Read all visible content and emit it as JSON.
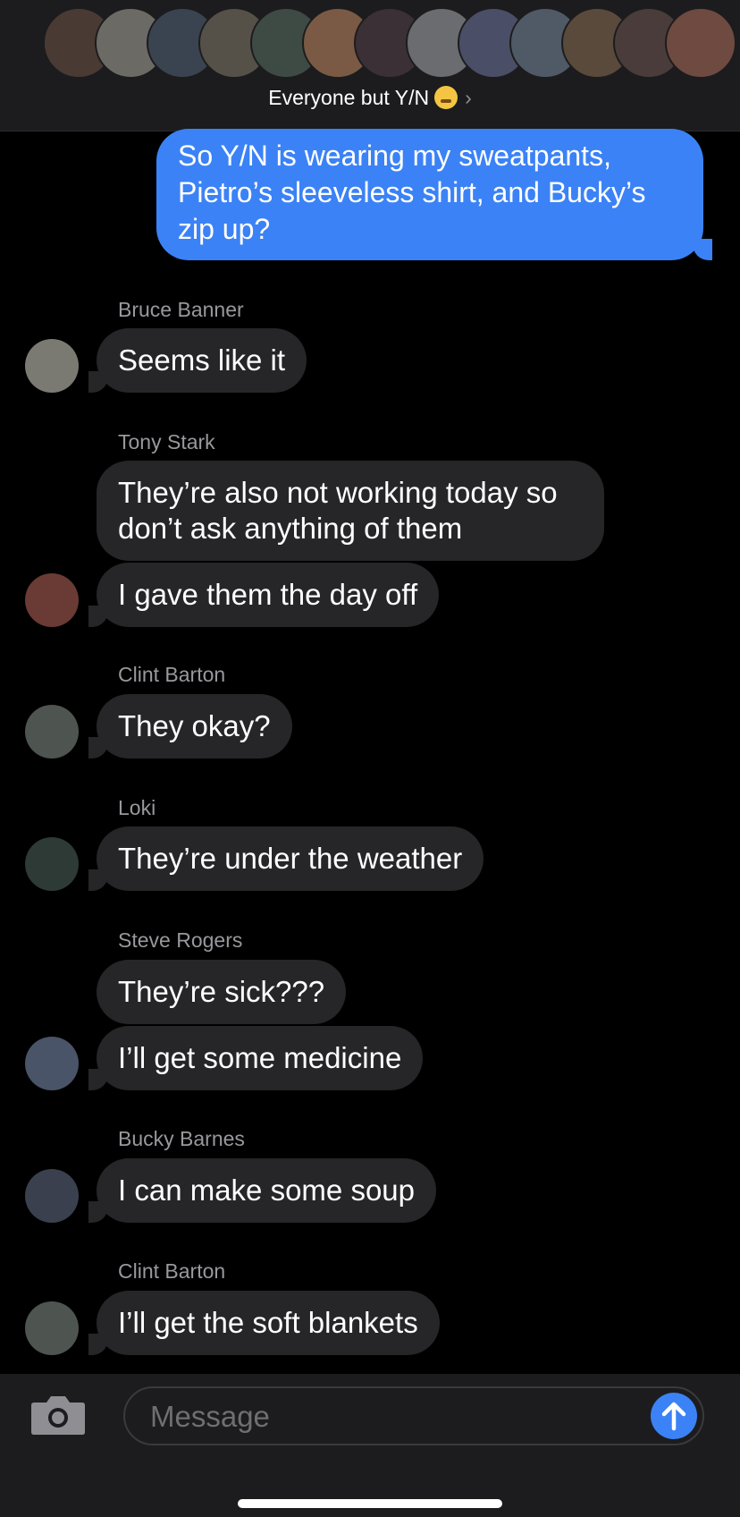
{
  "header": {
    "group_name": "Everyone but Y/N",
    "group_emoji": "shushing-face-emoji",
    "chevron": "›",
    "member_avatar_colors": [
      "#4a3a34",
      "#6b6a64",
      "#3a4450",
      "#555048",
      "#3e4a44",
      "#7a5a44",
      "#3a3036",
      "#6a6c70",
      "#4a4e66",
      "#505a66",
      "#5a4a3c",
      "#4a3c3a",
      "#6e4a40"
    ]
  },
  "thread": {
    "sent_message": "So Y/N is wearing my sweatpants, Pietro’s sleeveless shirt, and Bucky’s zip up?",
    "groups": [
      {
        "sender": "Bruce Banner",
        "messages": [
          "Seems like it"
        ],
        "avatar_color": "#7b7a72"
      },
      {
        "sender": "Tony Stark",
        "messages": [
          "They’re also not working today so don’t ask anything of them",
          "I gave them the day off"
        ],
        "avatar_color": "#6a3a34"
      },
      {
        "sender": "Clint Barton",
        "messages": [
          "They okay?"
        ],
        "avatar_color": "#4e5450"
      },
      {
        "sender": "Loki",
        "messages": [
          "They’re under the weather"
        ],
        "avatar_color": "#2e3a36"
      },
      {
        "sender": "Steve Rogers",
        "messages": [
          "They’re sick???",
          "I’ll get some medicine"
        ],
        "avatar_color": "#4a5468"
      },
      {
        "sender": "Bucky Barnes",
        "messages": [
          "I can make some soup"
        ],
        "avatar_color": "#3a404e"
      },
      {
        "sender": "Clint Barton",
        "messages": [
          "I’ll get the soft blankets"
        ],
        "avatar_color": "#4e5450"
      }
    ]
  },
  "composer": {
    "placeholder": "Message",
    "camera_icon": "camera-icon",
    "send_icon": "arrow-up-icon",
    "accent": "#3b82f6"
  }
}
